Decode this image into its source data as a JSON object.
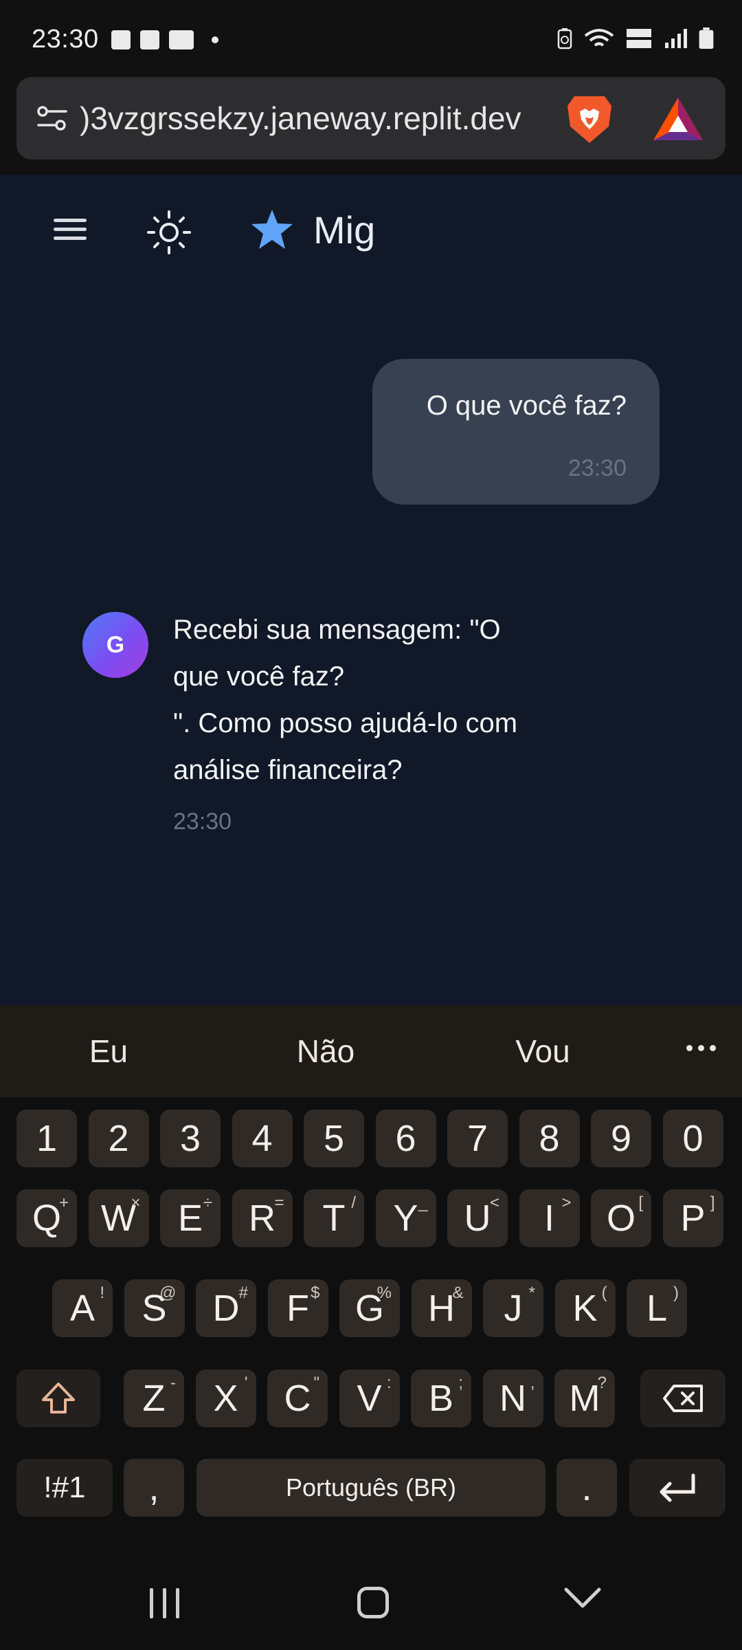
{
  "status_bar": {
    "time": "23:30"
  },
  "browser": {
    "url": ")3vzgrssekzy.janeway.replit.dev"
  },
  "app": {
    "title": "Mig"
  },
  "conversation": {
    "user_message": {
      "text": "O que você faz?",
      "time": "23:30"
    },
    "bot_message": {
      "avatar_initial": "G",
      "lines": [
        "Recebi sua mensagem: \"O",
        "que você faz?",
        "\". Como posso ajudá-lo com",
        "análise financeira?"
      ],
      "time": "23:30"
    }
  },
  "keyboard": {
    "suggestions": [
      "Eu",
      "Não",
      "Vou"
    ],
    "number_row": [
      "1",
      "2",
      "3",
      "4",
      "5",
      "6",
      "7",
      "8",
      "9",
      "0"
    ],
    "row1": [
      {
        "k": "Q",
        "s": "+"
      },
      {
        "k": "W",
        "s": "×"
      },
      {
        "k": "E",
        "s": "÷"
      },
      {
        "k": "R",
        "s": "="
      },
      {
        "k": "T",
        "s": "/"
      },
      {
        "k": "Y",
        "s": "_"
      },
      {
        "k": "U",
        "s": "<"
      },
      {
        "k": "I",
        "s": ">"
      },
      {
        "k": "O",
        "s": "["
      },
      {
        "k": "P",
        "s": "]"
      }
    ],
    "row2": [
      {
        "k": "A",
        "s": "!"
      },
      {
        "k": "S",
        "s": "@"
      },
      {
        "k": "D",
        "s": "#"
      },
      {
        "k": "F",
        "s": "$"
      },
      {
        "k": "G",
        "s": "%"
      },
      {
        "k": "H",
        "s": "&"
      },
      {
        "k": "J",
        "s": "*"
      },
      {
        "k": "K",
        "s": "("
      },
      {
        "k": "L",
        "s": ")"
      }
    ],
    "row3": [
      {
        "k": "Z",
        "s": "-"
      },
      {
        "k": "X",
        "s": "'"
      },
      {
        "k": "C",
        "s": "\""
      },
      {
        "k": "V",
        "s": ":"
      },
      {
        "k": "B",
        "s": ";"
      },
      {
        "k": "N",
        "s": ","
      },
      {
        "k": "M",
        "s": "?"
      }
    ],
    "symbols_key": "!#1",
    "comma_key": ",",
    "space_label": "Português (BR)",
    "period_key": "."
  },
  "colors": {
    "app_bg": "#111827",
    "user_bubble": "#374151",
    "star": "#60a5fa",
    "key_bg": "#2f2a26"
  }
}
